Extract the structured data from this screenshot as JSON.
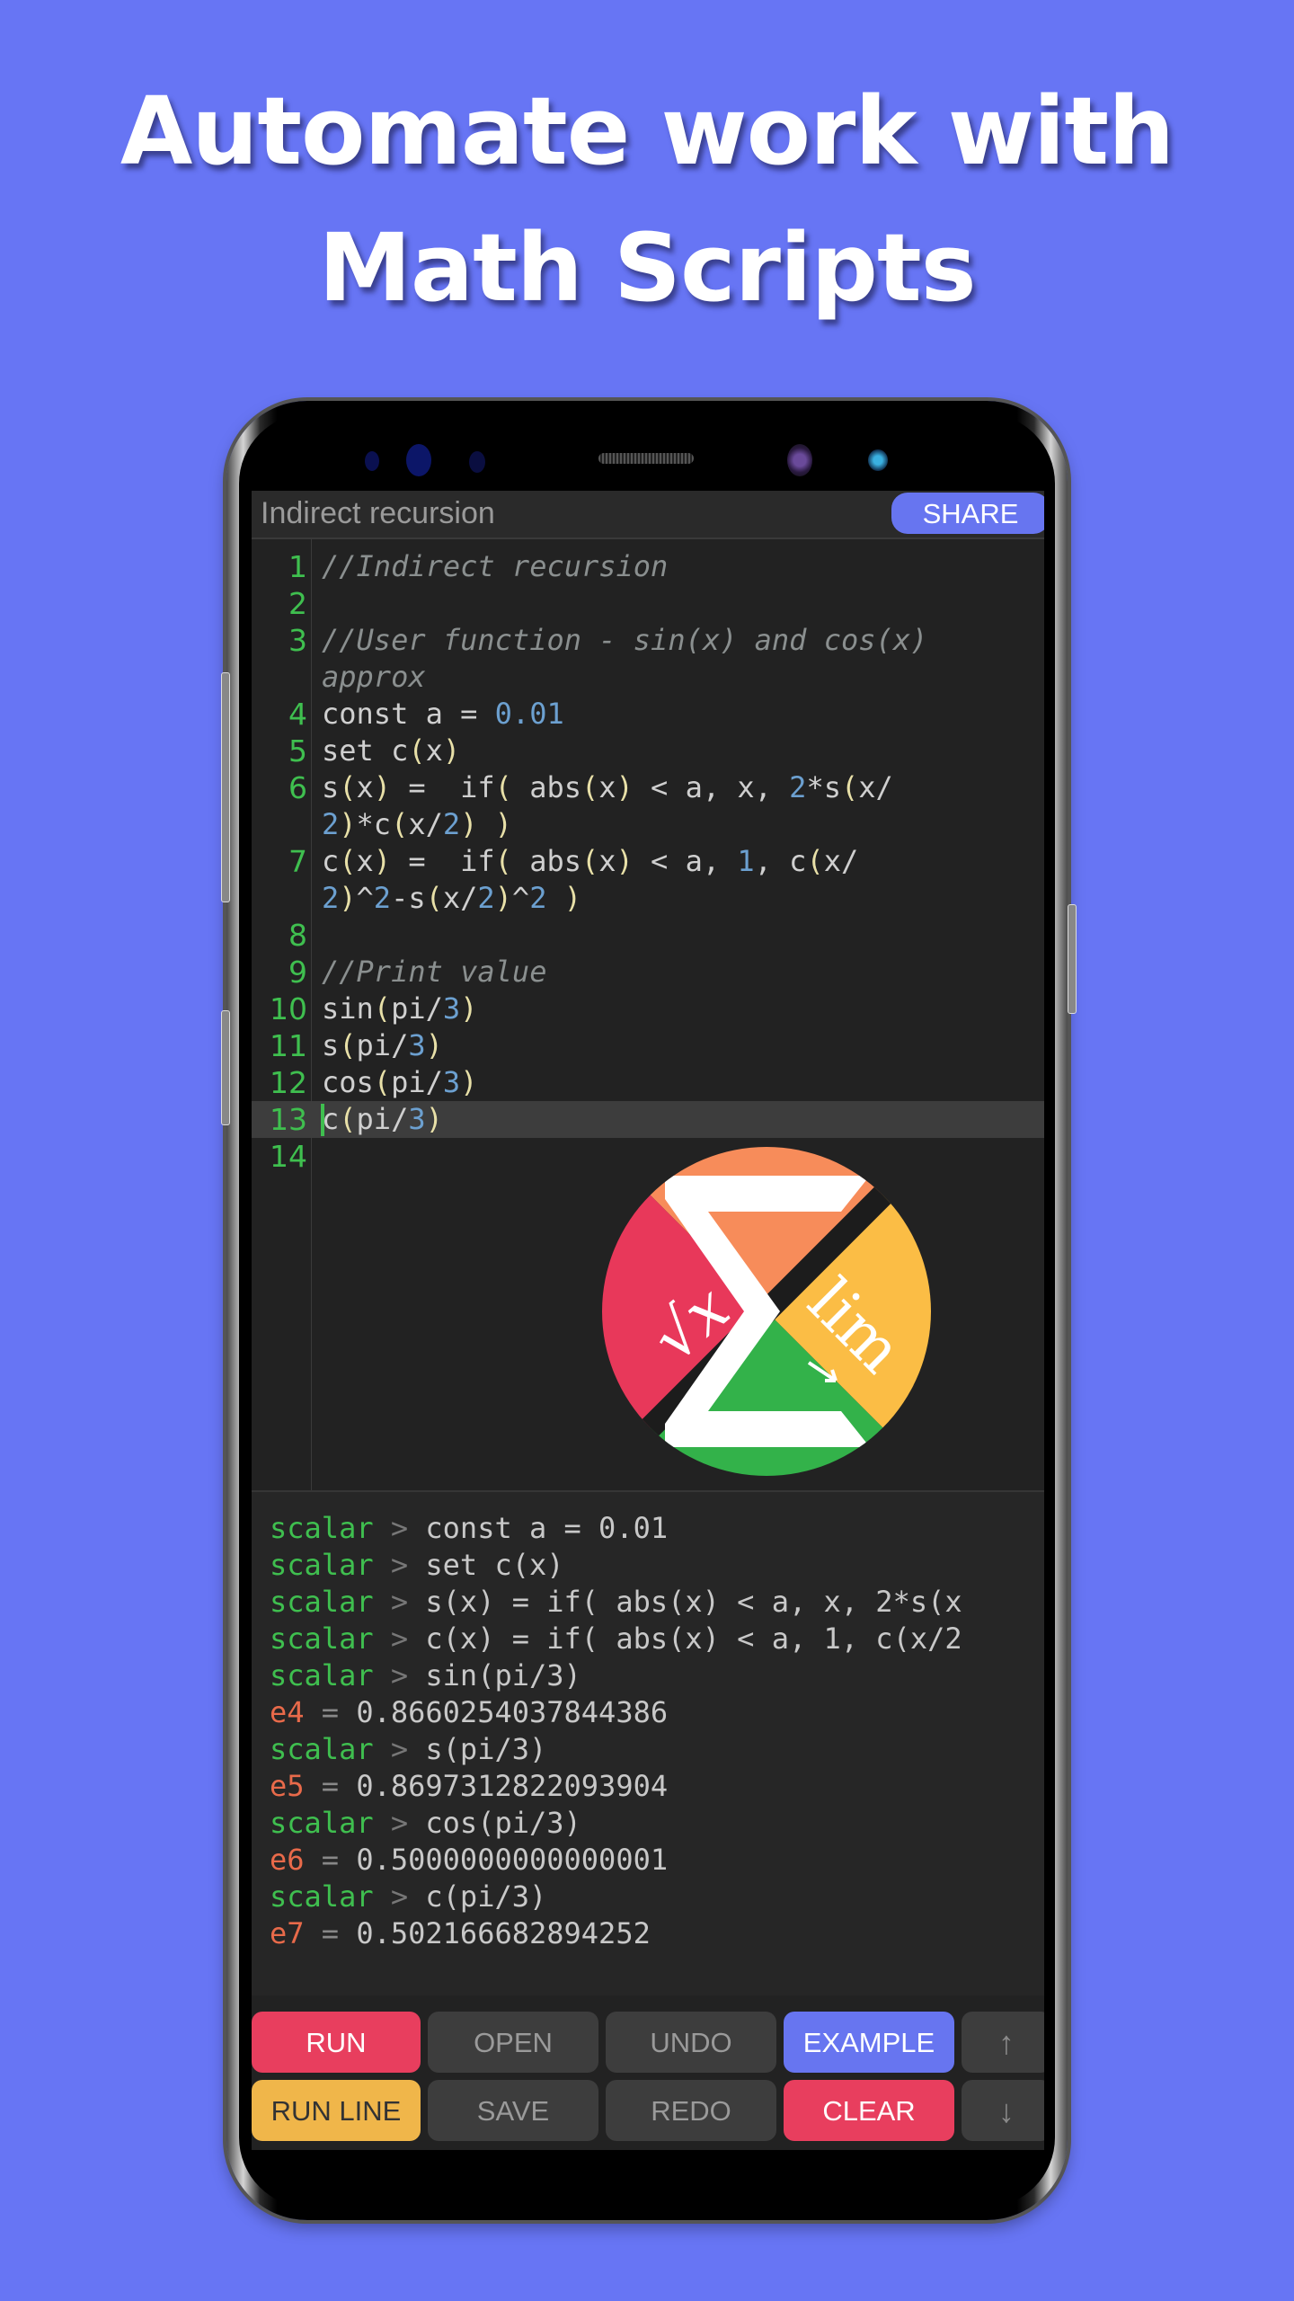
{
  "headline": {
    "line1": "Automate work with",
    "line2": "Math Scripts"
  },
  "app": {
    "document_title": "Indirect recursion",
    "share_label": "SHARE"
  },
  "editor": {
    "active_line": 13,
    "lines": [
      {
        "n": "1",
        "text": "//Indirect recursion"
      },
      {
        "n": "2",
        "text": ""
      },
      {
        "n": "3",
        "text": "//User function - sin(x) and cos(x)"
      },
      {
        "n": "",
        "text": "approx"
      },
      {
        "n": "4",
        "text": "const a = 0.01"
      },
      {
        "n": "5",
        "text": "set c(x)"
      },
      {
        "n": "6",
        "text": "s(x) =  if( abs(x) < a, x, 2*s(x/"
      },
      {
        "n": "",
        "text": "2)*c(x/2) )"
      },
      {
        "n": "7",
        "text": "c(x) =  if( abs(x) < a, 1, c(x/"
      },
      {
        "n": "",
        "text": "2)^2-s(x/2)^2 )"
      },
      {
        "n": "8",
        "text": ""
      },
      {
        "n": "9",
        "text": "//Print value"
      },
      {
        "n": "10",
        "text": "sin(pi/3)"
      },
      {
        "n": "11",
        "text": "s(pi/3)"
      },
      {
        "n": "12",
        "text": "cos(pi/3)"
      },
      {
        "n": "13",
        "text": "c(pi/3)"
      },
      {
        "n": "14",
        "text": ""
      }
    ]
  },
  "logo": {
    "name": "app-logo",
    "left_symbol": "√x",
    "right_symbol": "lim",
    "colors": {
      "top": "#f78c5a",
      "left": "#e8385a",
      "right": "#fbbd45",
      "bottom": "#33b24a"
    }
  },
  "console": {
    "lines": [
      {
        "type": "input",
        "prompt": "scalar",
        "text": "const a = 0.01"
      },
      {
        "type": "input",
        "prompt": "scalar",
        "text": "set c(x)"
      },
      {
        "type": "input",
        "prompt": "scalar",
        "text": "s(x) = if( abs(x) < a, x, 2*s(x"
      },
      {
        "type": "input",
        "prompt": "scalar",
        "text": "c(x) = if( abs(x) < a, 1, c(x/2"
      },
      {
        "type": "input",
        "prompt": "scalar",
        "text": "sin(pi/3)"
      },
      {
        "type": "result",
        "var": "e4",
        "value": "0.8660254037844386"
      },
      {
        "type": "input",
        "prompt": "scalar",
        "text": "s(pi/3)"
      },
      {
        "type": "result",
        "var": "e5",
        "value": "0.8697312822093904"
      },
      {
        "type": "input",
        "prompt": "scalar",
        "text": "cos(pi/3)"
      },
      {
        "type": "result",
        "var": "e6",
        "value": "0.5000000000000001"
      },
      {
        "type": "input",
        "prompt": "scalar",
        "text": "c(pi/3)"
      },
      {
        "type": "result",
        "var": "e7",
        "value": "0.502166682894252"
      }
    ]
  },
  "buttons": {
    "run": "RUN",
    "open": "OPEN",
    "undo": "UNDO",
    "example": "EXAMPLE",
    "up": "↑",
    "run_line": "RUN LINE",
    "save": "SAVE",
    "redo": "REDO",
    "clear": "CLEAR",
    "down": "↓"
  },
  "colors": {
    "background": "#6775f4",
    "accent_blue": "#6775f0",
    "run_red": "#e83e5e",
    "run_line_yellow": "#f0b64a",
    "line_number_green": "#3fbf4f"
  }
}
